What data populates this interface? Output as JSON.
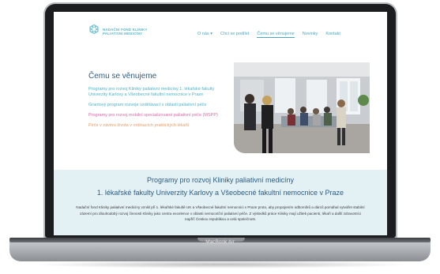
{
  "device": {
    "label": "MacBook Air"
  },
  "site": {
    "logo_line1": "NADAČNÍ FOND KLINIKY",
    "logo_line2": "PALIATIVNÍ MEDICÍNY",
    "nav": [
      {
        "label": "O nás ▾"
      },
      {
        "label": "Chci se podílet"
      },
      {
        "label": "Čemu se věnujeme"
      },
      {
        "label": "Novinky"
      },
      {
        "label": "Kontakt"
      }
    ],
    "section_title": "Čemu se věnujeme",
    "links": [
      "Programy pro rozvoj Kliniky paliativní medicíny 1. lékařské fakulty Univerzity Karlovy a Všeobecné fakultní nemocnice v Praze",
      "Grantový program rozvoje vzdělávací v oblasti paliativní péče",
      "Programy pro rozvoj mobilní specializované paliativní péče (MSPP)",
      "Péče v závěru života v ordinacích praktických lékařů"
    ],
    "band": {
      "title_line1": "Programy pro rozvoj Kliniky paliativní medicíny",
      "title_line2": "1. lékařské fakulty Univerzity Karlovy a Všeobecné fakultní nemocnice v Praze",
      "body": "Nadační fond Kliniky paliativní medicíny vznikl při 1. lékařské fakultě UK a Všeobecné fakultní nemocnici v Praze proto, aby propojením odborníků a dárců pomáhal vytvářet stabilní zázemí pro dlouhodobý rozvoj činnosti Kliniky jako centra excelence v oblasti nemocniční paliativní péče. Z výsledků práce Kliniky mají užitek pacienti, lékaři a další zdravotníci napříč Českou republikou a celá společnost."
    }
  },
  "colors": {
    "accent": "#4aa9c2",
    "title": "#2d5c80",
    "band": "#e3f1f5",
    "pink": "#d86aa9",
    "orange": "#e0a06e"
  }
}
